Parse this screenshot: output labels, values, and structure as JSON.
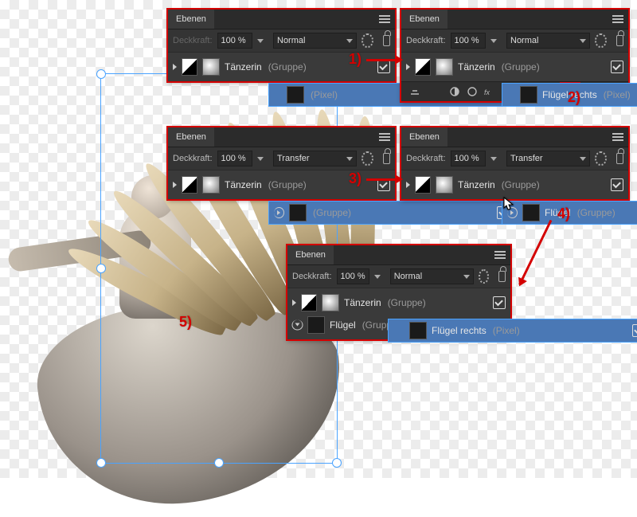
{
  "panel_title": "Ebenen",
  "opacity_label": "Deckkraft:",
  "opacity_label_dim": "Deckkraft:",
  "opacity_value": "100 %",
  "mode_normal": "Normal",
  "mode_transfer": "Transfer",
  "layers": {
    "pixel_unnamed": {
      "name": "",
      "suffix": "(Pixel)"
    },
    "fluegel_rechts": {
      "name": "Flügel rechts",
      "suffix": "(Pixel)"
    },
    "taenzerin": {
      "name": "Tänzerin",
      "suffix": "(Gruppe)"
    },
    "gruppe_unnamed": {
      "name": "",
      "suffix": "(Gruppe)"
    },
    "fluegel": {
      "name": "Flügel",
      "suffix": "(Gruppe)"
    }
  },
  "annotations": {
    "a1": "1)",
    "a2": "2)",
    "a3": "3)",
    "a4": "4)",
    "a5": "5)"
  }
}
